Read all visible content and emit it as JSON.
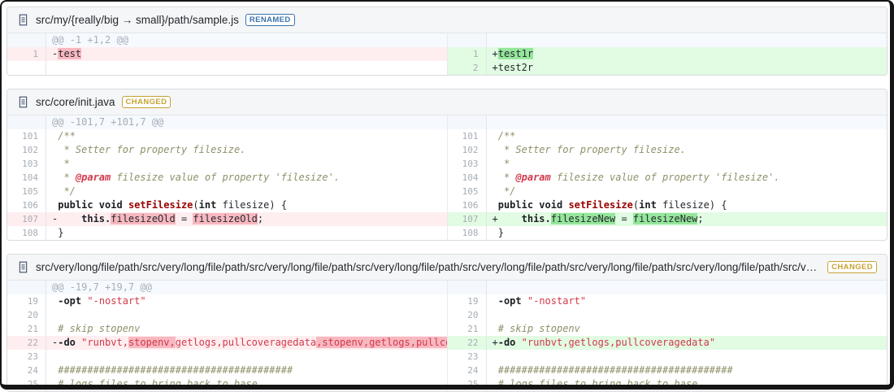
{
  "icons": {
    "file": "document-icon"
  },
  "colors": {
    "badge_renamed": "#3b73af",
    "badge_changed": "#c5a332",
    "removed_line_bg": "#ffeef0",
    "removed_word_bg": "#f8b8c0",
    "added_line_bg": "#e2fbe3",
    "added_word_bg": "#95e69b",
    "hunk_bg": "#f6f9fd",
    "string_color": "#d1394a",
    "comment_color": "#8f9069",
    "function_color": "#990000"
  },
  "files": [
    {
      "path": "src/my/{really/big → small}/path/sample.js",
      "badge": "RENAMED",
      "badge_color": "#3b73af",
      "hunk_header": "@@ -1 +1,2 @@",
      "left": [
        {
          "k": "h",
          "t": "@@ -1 +1,2 @@"
        },
        {
          "k": "r",
          "g": "1",
          "s": [
            [
              "-",
              ""
            ],
            [
              "test",
              "hl"
            ]
          ]
        },
        {
          "k": "f"
        }
      ],
      "right": [
        {
          "k": "h",
          "t": ""
        },
        {
          "k": "a",
          "g": "1",
          "s": [
            [
              "+",
              ""
            ],
            [
              "test1r",
              "hl"
            ]
          ]
        },
        {
          "k": "a",
          "g": "2",
          "s": [
            [
              "+test2r",
              ""
            ]
          ]
        }
      ]
    },
    {
      "path": "src/core/init.java",
      "badge": "CHANGED",
      "badge_color": "#c5a332",
      "hunk_header": "@@ -101,7 +101,7 @@",
      "left": [
        {
          "k": "h",
          "t": "@@ -101,7 +101,7 @@"
        },
        {
          "k": "c",
          "g": "101",
          "s": [
            [
              " /**",
              "c"
            ]
          ]
        },
        {
          "k": "c",
          "g": "102",
          "s": [
            [
              "  * Setter for property filesize.",
              "c"
            ]
          ]
        },
        {
          "k": "c",
          "g": "103",
          "s": [
            [
              "  *",
              "c"
            ]
          ]
        },
        {
          "k": "c",
          "g": "104",
          "s": [
            [
              "  * ",
              "c"
            ],
            [
              "@param",
              "doc"
            ],
            [
              " filesize value of property 'filesize'.",
              "c"
            ]
          ]
        },
        {
          "k": "c",
          "g": "105",
          "s": [
            [
              "  */",
              "c"
            ]
          ]
        },
        {
          "k": "c",
          "g": "106",
          "s": [
            [
              " ",
              ""
            ],
            [
              "public void ",
              "k"
            ],
            [
              "setFilesize",
              "fn"
            ],
            [
              "(",
              ""
            ],
            [
              "int",
              "k"
            ],
            [
              " filesize) {",
              ""
            ]
          ]
        },
        {
          "k": "r",
          "g": "107",
          "s": [
            [
              "-    ",
              ""
            ],
            [
              "this.",
              "k"
            ],
            [
              "filesizeOld",
              "hl"
            ],
            [
              " = ",
              ""
            ],
            [
              "filesizeOld",
              "hl"
            ],
            [
              ";",
              ""
            ]
          ]
        },
        {
          "k": "c",
          "g": "108",
          "s": [
            [
              " }",
              ""
            ]
          ]
        }
      ],
      "right": [
        {
          "k": "h",
          "t": ""
        },
        {
          "k": "c",
          "g": "101",
          "s": [
            [
              " /**",
              "c"
            ]
          ]
        },
        {
          "k": "c",
          "g": "102",
          "s": [
            [
              "  * Setter for property filesize.",
              "c"
            ]
          ]
        },
        {
          "k": "c",
          "g": "103",
          "s": [
            [
              "  *",
              "c"
            ]
          ]
        },
        {
          "k": "c",
          "g": "104",
          "s": [
            [
              "  * ",
              "c"
            ],
            [
              "@param",
              "doc"
            ],
            [
              " filesize value of property 'filesize'.",
              "c"
            ]
          ]
        },
        {
          "k": "c",
          "g": "105",
          "s": [
            [
              "  */",
              "c"
            ]
          ]
        },
        {
          "k": "c",
          "g": "106",
          "s": [
            [
              " ",
              ""
            ],
            [
              "public void ",
              "k"
            ],
            [
              "setFilesize",
              "fn"
            ],
            [
              "(",
              ""
            ],
            [
              "int",
              "k"
            ],
            [
              " filesize) {",
              ""
            ]
          ]
        },
        {
          "k": "a",
          "g": "107",
          "s": [
            [
              "+    ",
              ""
            ],
            [
              "this.",
              "k"
            ],
            [
              "filesizeNew",
              "hl"
            ],
            [
              " = ",
              ""
            ],
            [
              "filesizeNew",
              "hl"
            ],
            [
              ";",
              ""
            ]
          ]
        },
        {
          "k": "c",
          "g": "108",
          "s": [
            [
              " }",
              ""
            ]
          ]
        }
      ]
    },
    {
      "path": "src/very/long/file/path/src/very/long/file/path/src/very/long/file/path/src/very/long/file/path/src/very/long/file/path/src/very/long/file/path/src/very/long/file/path/src/very/long/file/path",
      "badge": "CHANGED",
      "badge_color": "#c5a332",
      "hunk_header": "@@ -19,7 +19,7 @@",
      "left": [
        {
          "k": "h",
          "t": "@@ -19,7 +19,7 @@"
        },
        {
          "k": "c",
          "g": "19",
          "s": [
            [
              " ",
              ""
            ],
            [
              "-opt",
              "k"
            ],
            [
              " ",
              ""
            ],
            [
              "\"-nostart\"",
              "s"
            ]
          ]
        },
        {
          "k": "c",
          "g": "20",
          "s": []
        },
        {
          "k": "c",
          "g": "21",
          "s": [
            [
              " # skip stopenv",
              "c"
            ]
          ]
        },
        {
          "k": "r",
          "g": "22",
          "s": [
            [
              "-",
              ""
            ],
            [
              "-do",
              "k"
            ],
            [
              " ",
              ""
            ],
            [
              "\"runbvt,",
              "s"
            ],
            [
              "stopenv,",
              "s hl"
            ],
            [
              "getlogs,pullcoveragedata",
              "s"
            ],
            [
              ",stopenv,getlogs,pullcoveragedata\"",
              "s hl"
            ]
          ]
        },
        {
          "k": "c",
          "g": "23",
          "s": []
        },
        {
          "k": "c",
          "g": "24",
          "s": [
            [
              " ########################################",
              "c"
            ]
          ]
        },
        {
          "k": "c",
          "g": "25",
          "s": [
            [
              " # logs files to bring back to base",
              "c"
            ]
          ]
        }
      ],
      "right": [
        {
          "k": "h",
          "t": ""
        },
        {
          "k": "c",
          "g": "19",
          "s": [
            [
              " ",
              ""
            ],
            [
              "-opt",
              "k"
            ],
            [
              " ",
              ""
            ],
            [
              "\"-nostart\"",
              "s"
            ]
          ]
        },
        {
          "k": "c",
          "g": "20",
          "s": []
        },
        {
          "k": "c",
          "g": "21",
          "s": [
            [
              " # skip stopenv",
              "c"
            ]
          ]
        },
        {
          "k": "a",
          "g": "22",
          "s": [
            [
              "+",
              ""
            ],
            [
              "-do",
              "k"
            ],
            [
              " ",
              ""
            ],
            [
              "\"runbvt,getlogs,pullcoveragedata\"",
              "s"
            ]
          ]
        },
        {
          "k": "c",
          "g": "23",
          "s": []
        },
        {
          "k": "c",
          "g": "24",
          "s": [
            [
              " ########################################",
              "c"
            ]
          ]
        },
        {
          "k": "c",
          "g": "25",
          "s": [
            [
              " # logs files to bring back to base",
              "c"
            ]
          ]
        }
      ]
    }
  ]
}
